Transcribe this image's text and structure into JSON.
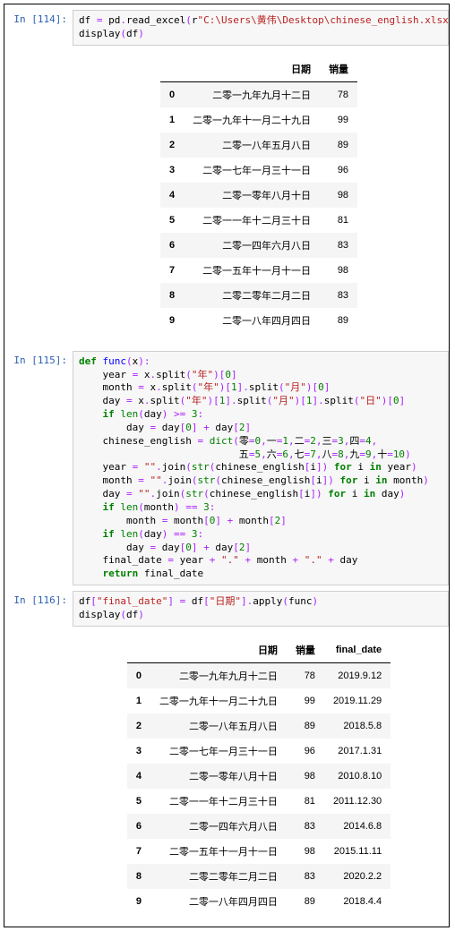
{
  "cells": [
    {
      "prompt": "In [114]:",
      "code_tokens": [
        [
          "id",
          "df "
        ],
        [
          "op",
          "="
        ],
        [
          "id",
          " pd"
        ],
        [
          "op",
          "."
        ],
        [
          "id",
          "read_excel"
        ],
        [
          "op",
          "("
        ],
        [
          "id",
          "r"
        ],
        [
          "str",
          "\"C:\\Users\\黄伟\\Desktop\\chinese_english.xlsx\""
        ],
        [
          "op",
          ")"
        ],
        [
          "nl",
          ""
        ],
        [
          "id",
          "display"
        ],
        [
          "op",
          "("
        ],
        [
          "id",
          "df"
        ],
        [
          "op",
          ")"
        ]
      ],
      "output_table": {
        "columns": [
          "日期",
          "销量"
        ],
        "rows": [
          {
            "idx": "0",
            "cells": [
              "二零一九年九月十二日",
              "78"
            ]
          },
          {
            "idx": "1",
            "cells": [
              "二零一九年十一月二十九日",
              "99"
            ]
          },
          {
            "idx": "2",
            "cells": [
              "二零一八年五月八日",
              "89"
            ]
          },
          {
            "idx": "3",
            "cells": [
              "二零一七年一月三十一日",
              "96"
            ]
          },
          {
            "idx": "4",
            "cells": [
              "二零一零年八月十日",
              "98"
            ]
          },
          {
            "idx": "5",
            "cells": [
              "二零一一年十二月三十日",
              "81"
            ]
          },
          {
            "idx": "6",
            "cells": [
              "二零一四年六月八日",
              "83"
            ]
          },
          {
            "idx": "7",
            "cells": [
              "二零一五年十一月十一日",
              "98"
            ]
          },
          {
            "idx": "8",
            "cells": [
              "二零二零年二月二日",
              "83"
            ]
          },
          {
            "idx": "9",
            "cells": [
              "二零一八年四月四日",
              "89"
            ]
          }
        ]
      }
    },
    {
      "prompt": "In [115]:",
      "code_tokens": [
        [
          "kw",
          "def"
        ],
        [
          "id",
          " "
        ],
        [
          "fn",
          "func"
        ],
        [
          "op",
          "("
        ],
        [
          "id",
          "x"
        ],
        [
          "op",
          ")"
        ],
        [
          "op",
          ":"
        ],
        [
          "nl",
          ""
        ],
        [
          "id",
          "    year "
        ],
        [
          "op",
          "="
        ],
        [
          "id",
          " x"
        ],
        [
          "op",
          "."
        ],
        [
          "id",
          "split"
        ],
        [
          "op",
          "("
        ],
        [
          "str",
          "\"年\""
        ],
        [
          "op",
          ")"
        ],
        [
          "op",
          "["
        ],
        [
          "num",
          "0"
        ],
        [
          "op",
          "]"
        ],
        [
          "nl",
          ""
        ],
        [
          "id",
          "    month "
        ],
        [
          "op",
          "="
        ],
        [
          "id",
          " x"
        ],
        [
          "op",
          "."
        ],
        [
          "id",
          "split"
        ],
        [
          "op",
          "("
        ],
        [
          "str",
          "\"年\""
        ],
        [
          "op",
          ")"
        ],
        [
          "op",
          "["
        ],
        [
          "num",
          "1"
        ],
        [
          "op",
          "]"
        ],
        [
          "op",
          "."
        ],
        [
          "id",
          "split"
        ],
        [
          "op",
          "("
        ],
        [
          "str",
          "\"月\""
        ],
        [
          "op",
          ")"
        ],
        [
          "op",
          "["
        ],
        [
          "num",
          "0"
        ],
        [
          "op",
          "]"
        ],
        [
          "nl",
          ""
        ],
        [
          "id",
          "    day "
        ],
        [
          "op",
          "="
        ],
        [
          "id",
          " x"
        ],
        [
          "op",
          "."
        ],
        [
          "id",
          "split"
        ],
        [
          "op",
          "("
        ],
        [
          "str",
          "\"年\""
        ],
        [
          "op",
          ")"
        ],
        [
          "op",
          "["
        ],
        [
          "num",
          "1"
        ],
        [
          "op",
          "]"
        ],
        [
          "op",
          "."
        ],
        [
          "id",
          "split"
        ],
        [
          "op",
          "("
        ],
        [
          "str",
          "\"月\""
        ],
        [
          "op",
          ")"
        ],
        [
          "op",
          "["
        ],
        [
          "num",
          "1"
        ],
        [
          "op",
          "]"
        ],
        [
          "op",
          "."
        ],
        [
          "id",
          "split"
        ],
        [
          "op",
          "("
        ],
        [
          "str",
          "\"日\""
        ],
        [
          "op",
          ")"
        ],
        [
          "op",
          "["
        ],
        [
          "num",
          "0"
        ],
        [
          "op",
          "]"
        ],
        [
          "nl",
          ""
        ],
        [
          "id",
          "    "
        ],
        [
          "kw",
          "if"
        ],
        [
          "id",
          " "
        ],
        [
          "bn",
          "len"
        ],
        [
          "op",
          "("
        ],
        [
          "id",
          "day"
        ],
        [
          "op",
          ")"
        ],
        [
          "id",
          " "
        ],
        [
          "op",
          ">="
        ],
        [
          "id",
          " "
        ],
        [
          "num",
          "3"
        ],
        [
          "op",
          ":"
        ],
        [
          "nl",
          ""
        ],
        [
          "id",
          "        day "
        ],
        [
          "op",
          "="
        ],
        [
          "id",
          " day"
        ],
        [
          "op",
          "["
        ],
        [
          "num",
          "0"
        ],
        [
          "op",
          "]"
        ],
        [
          "id",
          " "
        ],
        [
          "op",
          "+"
        ],
        [
          "id",
          " day"
        ],
        [
          "op",
          "["
        ],
        [
          "num",
          "2"
        ],
        [
          "op",
          "]"
        ],
        [
          "nl",
          ""
        ],
        [
          "id",
          "    chinese_english "
        ],
        [
          "op",
          "="
        ],
        [
          "id",
          " "
        ],
        [
          "bn",
          "dict"
        ],
        [
          "op",
          "("
        ],
        [
          "id",
          "零"
        ],
        [
          "op",
          "="
        ],
        [
          "num",
          "0"
        ],
        [
          "op",
          ","
        ],
        [
          "id",
          "一"
        ],
        [
          "op",
          "="
        ],
        [
          "num",
          "1"
        ],
        [
          "op",
          ","
        ],
        [
          "id",
          "二"
        ],
        [
          "op",
          "="
        ],
        [
          "num",
          "2"
        ],
        [
          "op",
          ","
        ],
        [
          "id",
          "三"
        ],
        [
          "op",
          "="
        ],
        [
          "num",
          "3"
        ],
        [
          "op",
          ","
        ],
        [
          "id",
          "四"
        ],
        [
          "op",
          "="
        ],
        [
          "num",
          "4"
        ],
        [
          "op",
          ","
        ],
        [
          "nl",
          ""
        ],
        [
          "id",
          "                           五"
        ],
        [
          "op",
          "="
        ],
        [
          "num",
          "5"
        ],
        [
          "op",
          ","
        ],
        [
          "id",
          "六"
        ],
        [
          "op",
          "="
        ],
        [
          "num",
          "6"
        ],
        [
          "op",
          ","
        ],
        [
          "id",
          "七"
        ],
        [
          "op",
          "="
        ],
        [
          "num",
          "7"
        ],
        [
          "op",
          ","
        ],
        [
          "id",
          "八"
        ],
        [
          "op",
          "="
        ],
        [
          "num",
          "8"
        ],
        [
          "op",
          ","
        ],
        [
          "id",
          "九"
        ],
        [
          "op",
          "="
        ],
        [
          "num",
          "9"
        ],
        [
          "op",
          ","
        ],
        [
          "id",
          "十"
        ],
        [
          "op",
          "="
        ],
        [
          "num",
          "10"
        ],
        [
          "op",
          ")"
        ],
        [
          "nl",
          ""
        ],
        [
          "id",
          "    year "
        ],
        [
          "op",
          "="
        ],
        [
          "id",
          " "
        ],
        [
          "str",
          "\"\""
        ],
        [
          "op",
          "."
        ],
        [
          "id",
          "join"
        ],
        [
          "op",
          "("
        ],
        [
          "bn",
          "str"
        ],
        [
          "op",
          "("
        ],
        [
          "id",
          "chinese_english"
        ],
        [
          "op",
          "["
        ],
        [
          "id",
          "i"
        ],
        [
          "op",
          "]"
        ],
        [
          "op",
          ")"
        ],
        [
          "id",
          " "
        ],
        [
          "kw",
          "for"
        ],
        [
          "id",
          " i "
        ],
        [
          "kw",
          "in"
        ],
        [
          "id",
          " year"
        ],
        [
          "op",
          ")"
        ],
        [
          "nl",
          ""
        ],
        [
          "id",
          "    month "
        ],
        [
          "op",
          "="
        ],
        [
          "id",
          " "
        ],
        [
          "str",
          "\"\""
        ],
        [
          "op",
          "."
        ],
        [
          "id",
          "join"
        ],
        [
          "op",
          "("
        ],
        [
          "bn",
          "str"
        ],
        [
          "op",
          "("
        ],
        [
          "id",
          "chinese_english"
        ],
        [
          "op",
          "["
        ],
        [
          "id",
          "i"
        ],
        [
          "op",
          "]"
        ],
        [
          "op",
          ")"
        ],
        [
          "id",
          " "
        ],
        [
          "kw",
          "for"
        ],
        [
          "id",
          " i "
        ],
        [
          "kw",
          "in"
        ],
        [
          "id",
          " month"
        ],
        [
          "op",
          ")"
        ],
        [
          "nl",
          ""
        ],
        [
          "id",
          "    day "
        ],
        [
          "op",
          "="
        ],
        [
          "id",
          " "
        ],
        [
          "str",
          "\"\""
        ],
        [
          "op",
          "."
        ],
        [
          "id",
          "join"
        ],
        [
          "op",
          "("
        ],
        [
          "bn",
          "str"
        ],
        [
          "op",
          "("
        ],
        [
          "id",
          "chinese_english"
        ],
        [
          "op",
          "["
        ],
        [
          "id",
          "i"
        ],
        [
          "op",
          "]"
        ],
        [
          "op",
          ")"
        ],
        [
          "id",
          " "
        ],
        [
          "kw",
          "for"
        ],
        [
          "id",
          " i "
        ],
        [
          "kw",
          "in"
        ],
        [
          "id",
          " day"
        ],
        [
          "op",
          ")"
        ],
        [
          "nl",
          ""
        ],
        [
          "id",
          "    "
        ],
        [
          "kw",
          "if"
        ],
        [
          "id",
          " "
        ],
        [
          "bn",
          "len"
        ],
        [
          "op",
          "("
        ],
        [
          "id",
          "month"
        ],
        [
          "op",
          ")"
        ],
        [
          "id",
          " "
        ],
        [
          "op",
          "=="
        ],
        [
          "id",
          " "
        ],
        [
          "num",
          "3"
        ],
        [
          "op",
          ":"
        ],
        [
          "nl",
          ""
        ],
        [
          "id",
          "        month "
        ],
        [
          "op",
          "="
        ],
        [
          "id",
          " month"
        ],
        [
          "op",
          "["
        ],
        [
          "num",
          "0"
        ],
        [
          "op",
          "]"
        ],
        [
          "id",
          " "
        ],
        [
          "op",
          "+"
        ],
        [
          "id",
          " month"
        ],
        [
          "op",
          "["
        ],
        [
          "num",
          "2"
        ],
        [
          "op",
          "]"
        ],
        [
          "nl",
          ""
        ],
        [
          "id",
          "    "
        ],
        [
          "kw",
          "if"
        ],
        [
          "id",
          " "
        ],
        [
          "bn",
          "len"
        ],
        [
          "op",
          "("
        ],
        [
          "id",
          "day"
        ],
        [
          "op",
          ")"
        ],
        [
          "id",
          " "
        ],
        [
          "op",
          "=="
        ],
        [
          "id",
          " "
        ],
        [
          "num",
          "3"
        ],
        [
          "op",
          ":"
        ],
        [
          "nl",
          ""
        ],
        [
          "id",
          "        day "
        ],
        [
          "op",
          "="
        ],
        [
          "id",
          " day"
        ],
        [
          "op",
          "["
        ],
        [
          "num",
          "0"
        ],
        [
          "op",
          "]"
        ],
        [
          "id",
          " "
        ],
        [
          "op",
          "+"
        ],
        [
          "id",
          " day"
        ],
        [
          "op",
          "["
        ],
        [
          "num",
          "2"
        ],
        [
          "op",
          "]"
        ],
        [
          "nl",
          ""
        ],
        [
          "id",
          "    final_date "
        ],
        [
          "op",
          "="
        ],
        [
          "id",
          " year "
        ],
        [
          "op",
          "+"
        ],
        [
          "id",
          " "
        ],
        [
          "str",
          "\".\""
        ],
        [
          "id",
          " "
        ],
        [
          "op",
          "+"
        ],
        [
          "id",
          " month "
        ],
        [
          "op",
          "+"
        ],
        [
          "id",
          " "
        ],
        [
          "str",
          "\".\""
        ],
        [
          "id",
          " "
        ],
        [
          "op",
          "+"
        ],
        [
          "id",
          " day"
        ],
        [
          "nl",
          ""
        ],
        [
          "id",
          "    "
        ],
        [
          "kw",
          "return"
        ],
        [
          "id",
          " final_date"
        ]
      ]
    },
    {
      "prompt": "In [116]:",
      "code_tokens": [
        [
          "id",
          "df"
        ],
        [
          "op",
          "["
        ],
        [
          "str",
          "\"final_date\""
        ],
        [
          "op",
          "]"
        ],
        [
          "id",
          " "
        ],
        [
          "op",
          "="
        ],
        [
          "id",
          " df"
        ],
        [
          "op",
          "["
        ],
        [
          "str",
          "\"日期\""
        ],
        [
          "op",
          "]"
        ],
        [
          "op",
          "."
        ],
        [
          "id",
          "apply"
        ],
        [
          "op",
          "("
        ],
        [
          "id",
          "func"
        ],
        [
          "op",
          ")"
        ],
        [
          "nl",
          ""
        ],
        [
          "id",
          "display"
        ],
        [
          "op",
          "("
        ],
        [
          "id",
          "df"
        ],
        [
          "op",
          ")"
        ]
      ],
      "output_table": {
        "columns": [
          "日期",
          "销量",
          "final_date"
        ],
        "rows": [
          {
            "idx": "0",
            "cells": [
              "二零一九年九月十二日",
              "78",
              "2019.9.12"
            ]
          },
          {
            "idx": "1",
            "cells": [
              "二零一九年十一月二十九日",
              "99",
              "2019.11.29"
            ]
          },
          {
            "idx": "2",
            "cells": [
              "二零一八年五月八日",
              "89",
              "2018.5.8"
            ]
          },
          {
            "idx": "3",
            "cells": [
              "二零一七年一月三十一日",
              "96",
              "2017.1.31"
            ]
          },
          {
            "idx": "4",
            "cells": [
              "二零一零年八月十日",
              "98",
              "2010.8.10"
            ]
          },
          {
            "idx": "5",
            "cells": [
              "二零一一年十二月三十日",
              "81",
              "2011.12.30"
            ]
          },
          {
            "idx": "6",
            "cells": [
              "二零一四年六月八日",
              "83",
              "2014.6.8"
            ]
          },
          {
            "idx": "7",
            "cells": [
              "二零一五年十一月十一日",
              "98",
              "2015.11.11"
            ]
          },
          {
            "idx": "8",
            "cells": [
              "二零二零年二月二日",
              "83",
              "2020.2.2"
            ]
          },
          {
            "idx": "9",
            "cells": [
              "二零一八年四月四日",
              "89",
              "2018.4.4"
            ]
          }
        ]
      }
    }
  ]
}
